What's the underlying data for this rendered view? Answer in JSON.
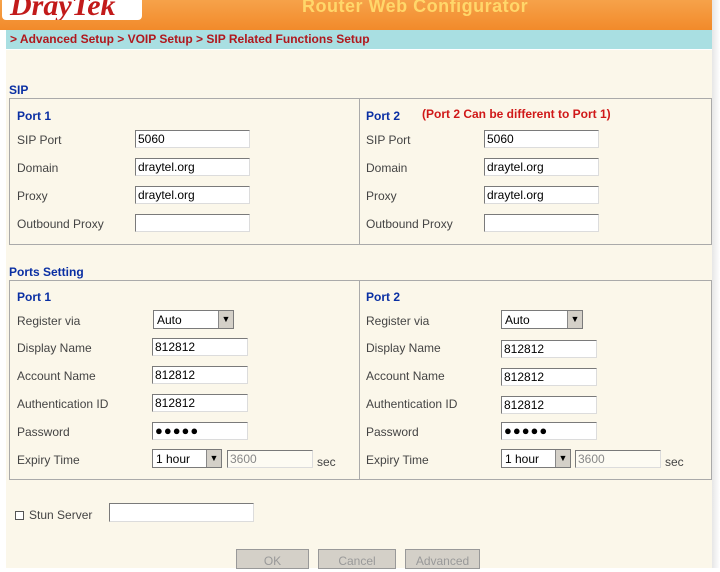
{
  "header": {
    "logo": "DrayTek",
    "app_title": "Router Web Configurator"
  },
  "breadcrumb": "> Advanced Setup > VOIP Setup > SIP Related Functions Setup",
  "sip": {
    "title": "SIP",
    "note": "(Port 2 Can be different to Port 1)",
    "port1": {
      "title": "Port 1",
      "sip_port_label": "SIP Port",
      "sip_port": "5060",
      "domain_label": "Domain",
      "domain": "draytel.org",
      "proxy_label": "Proxy",
      "proxy": "draytel.org",
      "outbound_label": "Outbound Proxy",
      "outbound": ""
    },
    "port2": {
      "title": "Port 2",
      "sip_port_label": "SIP Port",
      "sip_port": "5060",
      "domain_label": "Domain",
      "domain": "draytel.org",
      "proxy_label": "Proxy",
      "proxy": "draytel.org",
      "outbound_label": "Outbound Proxy",
      "outbound": ""
    }
  },
  "ports_setting": {
    "title": "Ports Setting",
    "port1": {
      "title": "Port 1",
      "register_label": "Register via",
      "register": "Auto",
      "display_label": "Display Name",
      "display": "812812",
      "account_label": "Account Name",
      "account": "812812",
      "auth_label": "Authentication ID",
      "auth": "812812",
      "password_label": "Password",
      "password": "●●●●●",
      "expiry_label": "Expiry Time",
      "expiry": "1 hour",
      "expiry_value": "3600",
      "sec": "sec"
    },
    "port2": {
      "title": "Port 2",
      "register_label": "Register via",
      "register": "Auto",
      "display_label": "Display Name",
      "display": "812812",
      "account_label": "Account Name",
      "account": "812812",
      "auth_label": "Authentication ID",
      "auth": "812812",
      "password_label": "Password",
      "password": "●●●●●",
      "expiry_label": "Expiry Time",
      "expiry": "1 hour",
      "expiry_value": "3600",
      "sec": "sec"
    }
  },
  "stun": {
    "label": "Stun Server",
    "value": ""
  },
  "buttons": {
    "ok": "OK",
    "cancel": "Cancel",
    "advanced": "Advanced"
  },
  "colors": {
    "header": "#f28a2a",
    "breadcrumb_bg": "#a9dfe2",
    "breadcrumb_text": "#b0181d",
    "content_bg": "#fbf7ea",
    "section_title": "#0a2fa3",
    "note": "#d01818"
  },
  "icons": {
    "dropdown": "chevron-down-icon"
  }
}
